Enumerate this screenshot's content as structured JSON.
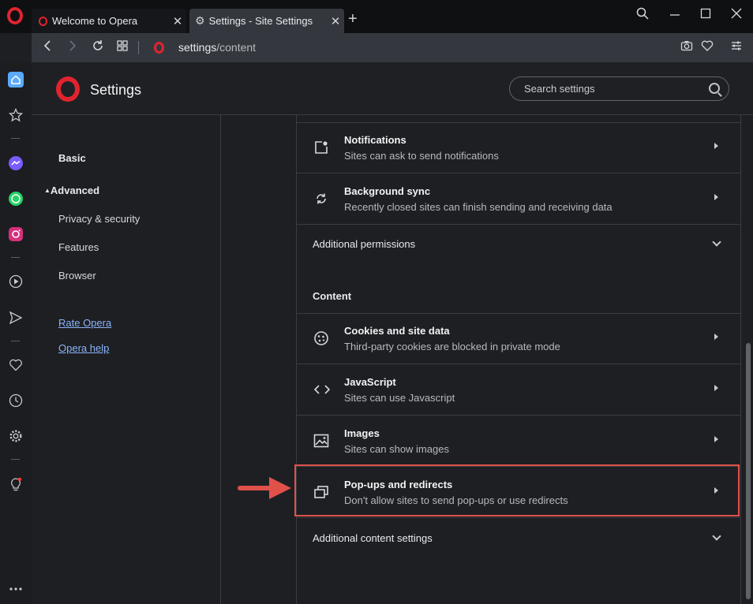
{
  "browser": {
    "tabs": [
      {
        "title": "Welcome to Opera",
        "active": false
      },
      {
        "title": "Settings - Site Settings",
        "active": true
      }
    ],
    "url_host": "settings",
    "url_path": "/content",
    "accent_color": "#e0242e"
  },
  "sidebar_icons": [
    "home-icon",
    "star-icon",
    "messenger-icon",
    "whatsapp-icon",
    "instagram-icon",
    "player-icon",
    "send-icon",
    "heart-icon",
    "history-icon",
    "gear-icon",
    "lightbulb-icon",
    "more-icon"
  ],
  "settings": {
    "title": "Settings",
    "search_placeholder": "Search settings",
    "nav": {
      "basic": "Basic",
      "advanced": "Advanced",
      "privacy": "Privacy & security",
      "features": "Features",
      "browser": "Browser",
      "rate": "Rate Opera",
      "help": "Opera help"
    },
    "rows_top": [
      {
        "title": "Notifications",
        "subtitle": "Sites can ask to send notifications",
        "icon": "notification-icon"
      },
      {
        "title": "Background sync",
        "subtitle": "Recently closed sites can finish sending and receiving data",
        "icon": "sync-icon"
      }
    ],
    "additional_permissions": "Additional permissions",
    "content_heading": "Content",
    "rows_content": [
      {
        "title": "Cookies and site data",
        "subtitle": "Third-party cookies are blocked in private mode",
        "icon": "cookie-icon"
      },
      {
        "title": "JavaScript",
        "subtitle": "Sites can use Javascript",
        "icon": "code-icon"
      },
      {
        "title": "Images",
        "subtitle": "Sites can show images",
        "icon": "image-icon"
      },
      {
        "title": "Pop-ups and redirects",
        "subtitle": "Don't allow sites to send pop-ups or use redirects",
        "icon": "popup-icon",
        "highlighted": true
      }
    ],
    "additional_content": "Additional content settings",
    "highlight_color": "#e0514a"
  }
}
